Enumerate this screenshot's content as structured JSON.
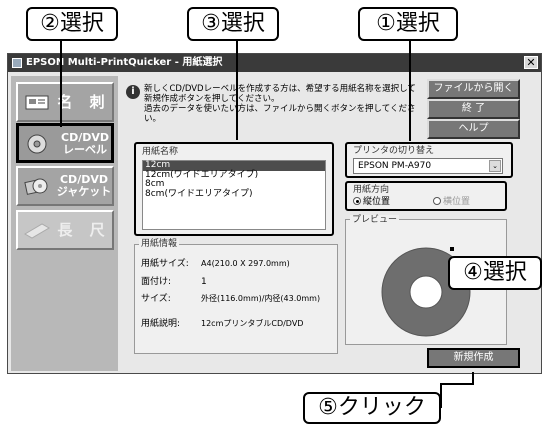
{
  "callouts": {
    "c1": "①選択",
    "c2": "②選択",
    "c3": "③選択",
    "c4": "④選択",
    "c5": "⑤クリック"
  },
  "window": {
    "title": "EPSON Multi-PrintQuicker - 用紙選択",
    "close_glyph": "✕"
  },
  "sidebar": {
    "items": [
      {
        "label": "名 刺",
        "icon": "business-card-icon"
      },
      {
        "label": "CD/DVD\nレーベル",
        "icon": "cd-label-icon"
      },
      {
        "label": "CD/DVD\nジャケット",
        "icon": "cd-jacket-icon"
      },
      {
        "label": "長 尺",
        "icon": "long-paper-icon"
      }
    ]
  },
  "info": {
    "text": "新しくCD/DVDレーベルを作成する方は、希望する用紙名称を選択して\n新規作成ボタンを押してください。\n過去のデータを使いたい方は、ファイルから開くボタンを押してください。"
  },
  "buttons": {
    "open_file": "ファイルから開く",
    "exit": "終 了",
    "help": "ヘルプ",
    "new_create": "新規作成"
  },
  "paper_name": {
    "title": "用紙名称",
    "items": [
      "12cm",
      "12cm(ワイドエリアタイプ)",
      "8cm",
      "8cm(ワイドエリアタイプ)"
    ],
    "selected_index": 0
  },
  "paper_info": {
    "title": "用紙情報",
    "size_label": "用紙サイズ:",
    "size_value": "A4(210.0 X 297.0mm)",
    "faces_label": "面付け:",
    "faces_value": "1",
    "dims_label": "サイズ:",
    "dims_value": "外径(116.0mm)/内径(43.0mm)",
    "desc_label": "用紙説明:",
    "desc_value": "12cmプリンタブルCD/DVD"
  },
  "printer": {
    "title": "プリンタの切り替え",
    "selected": "EPSON PM-A970",
    "arrow": "⌄"
  },
  "orientation": {
    "title": "用紙方向",
    "options": [
      "縦位置",
      "横位置"
    ],
    "selected_index": 0
  },
  "preview": {
    "title": "プレビュー"
  },
  "colors": {
    "disc": "#6e6e6e",
    "hole": "#ffffff",
    "selection": "#4d4d4d"
  }
}
